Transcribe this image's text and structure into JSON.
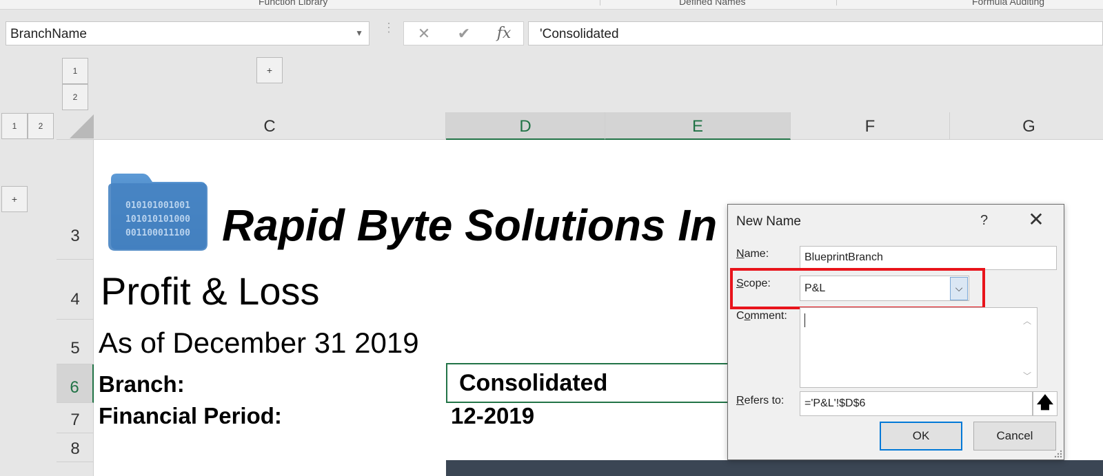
{
  "ribbon": {
    "groups": [
      "Function Library",
      "Defined Names",
      "Formula Auditing"
    ]
  },
  "formula_bar": {
    "name_box": "BranchName",
    "cancel_icon": "✕",
    "enter_icon": "✔",
    "fx_icon": "fx",
    "formula": "'Consolidated"
  },
  "outline": {
    "row_levels": [
      "1",
      "2"
    ],
    "col_levels": [
      "1",
      "2"
    ],
    "expand": "+"
  },
  "columns": [
    "C",
    "D",
    "E",
    "F",
    "G"
  ],
  "rows": [
    "3",
    "4",
    "5",
    "6",
    "7",
    "8"
  ],
  "sheet": {
    "company": "Rapid Byte Solutions In",
    "logo_binary": [
      "010101001001",
      "101010101000",
      "001100011100"
    ],
    "title": "Profit & Loss",
    "as_of": "As of December 31 2019",
    "branch_label": "Branch:",
    "branch_value": "Consolidated",
    "period_label": "Financial Period:",
    "period_value": "12-2019"
  },
  "dialog": {
    "title": "New Name",
    "help": "?",
    "close": "✕",
    "name_label_u": "N",
    "name_label_rest": "ame:",
    "name_value": "BlueprintBranch",
    "scope_label_u": "S",
    "scope_label_rest": "cope:",
    "scope_value": "P&L",
    "comment_label_pre": "C",
    "comment_label_u": "o",
    "comment_label_rest": "mment:",
    "comment_value": "",
    "refers_label_u": "R",
    "refers_label_rest": "efers to:",
    "refers_value": "='P&L'!$D$6",
    "ok": "OK",
    "cancel": "Cancel"
  },
  "colors": {
    "excel_green": "#217346",
    "highlight_red": "#e8141b",
    "logo_blue": "#3f7fbf"
  }
}
